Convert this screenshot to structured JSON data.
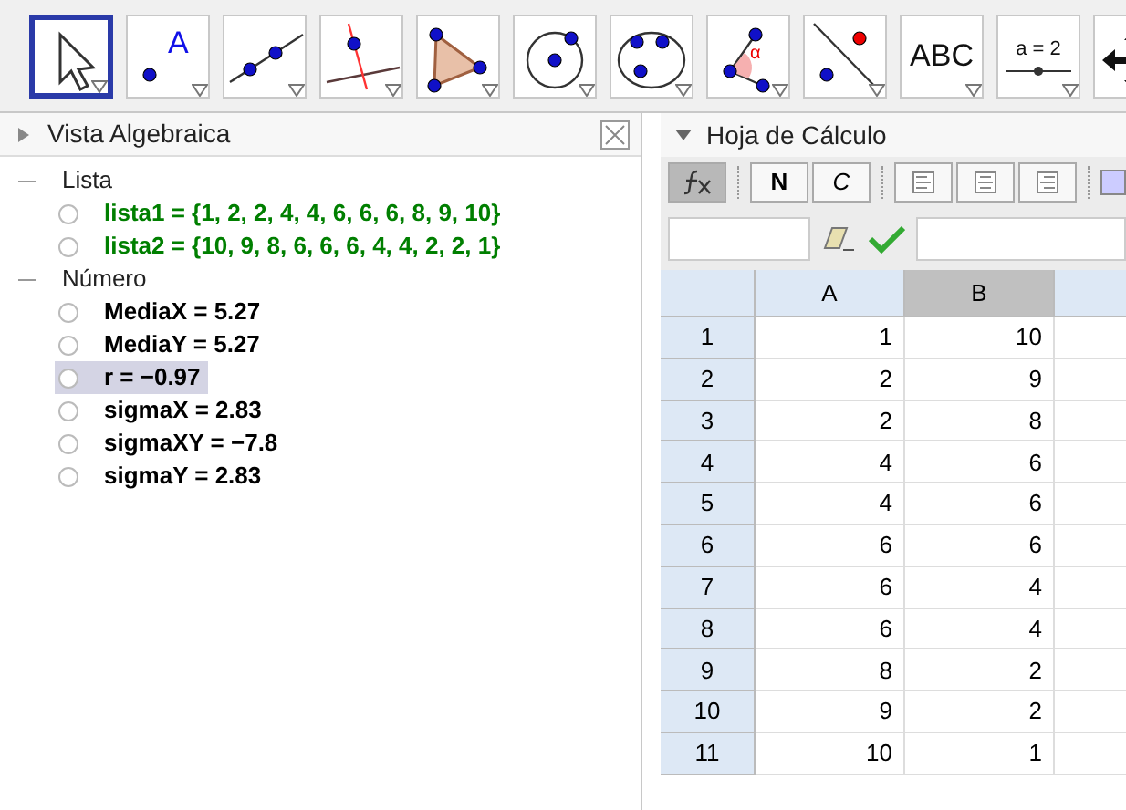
{
  "toolbar": [
    {
      "kind": "move",
      "selected": true,
      "menu_arrow": true
    },
    {
      "kind": "point",
      "label": "A",
      "selected": false,
      "menu_arrow": true
    },
    {
      "kind": "line",
      "selected": false,
      "menu_arrow": true
    },
    {
      "kind": "perpendicular",
      "selected": false,
      "menu_arrow": true
    },
    {
      "kind": "polygon",
      "selected": false,
      "menu_arrow": true
    },
    {
      "kind": "circle",
      "selected": false,
      "menu_arrow": true
    },
    {
      "kind": "conic",
      "selected": false,
      "menu_arrow": true
    },
    {
      "kind": "angle",
      "label": "α",
      "selected": false,
      "menu_arrow": true
    },
    {
      "kind": "reflect",
      "selected": false,
      "menu_arrow": true
    },
    {
      "kind": "text",
      "label": "ABC",
      "selected": false,
      "menu_arrow": true
    },
    {
      "kind": "slider",
      "label": "a = 2",
      "selected": false,
      "menu_arrow": true
    },
    {
      "kind": "pan",
      "selected": false,
      "menu_arrow": false
    }
  ],
  "algebra_view": {
    "title": "Vista Algebraica",
    "groups": [
      {
        "name": "Lista",
        "expanded": true,
        "items": [
          {
            "text": "lista1 = {1, 2, 2, 4, 4, 6, 6, 6, 8, 9, 10}",
            "color": "#007f00",
            "selected": false
          },
          {
            "text": "lista2 = {10, 9, 8, 6, 6, 6, 4, 4, 2, 2, 1}",
            "color": "#007f00",
            "selected": false
          }
        ]
      },
      {
        "name": "Número",
        "expanded": true,
        "items": [
          {
            "text": "MediaX = 5.27",
            "color": "#000000",
            "selected": false
          },
          {
            "text": "MediaY = 5.27",
            "color": "#000000",
            "selected": false
          },
          {
            "text": "r = −0.97",
            "color": "#000000",
            "selected": true
          },
          {
            "text": "sigmaX = 2.83",
            "color": "#000000",
            "selected": false
          },
          {
            "text": "sigmaXY = −7.8",
            "color": "#000000",
            "selected": false
          },
          {
            "text": "sigmaY = 2.83",
            "color": "#000000",
            "selected": false
          }
        ]
      }
    ]
  },
  "spreadsheet": {
    "title": "Hoja de Cálculo",
    "style_buttons": [
      {
        "kind": "fx",
        "selected": true
      },
      {
        "kind": "bold",
        "label": "N",
        "selected": false
      },
      {
        "kind": "italic",
        "label": "C",
        "selected": false
      },
      {
        "kind": "align-left",
        "selected": false
      },
      {
        "kind": "align-center",
        "selected": false
      },
      {
        "kind": "align-right",
        "selected": false
      }
    ],
    "columns": [
      {
        "label": "A",
        "selected": false
      },
      {
        "label": "B",
        "selected": true
      }
    ],
    "rows": [
      {
        "label": "1",
        "cells": [
          "1",
          "10"
        ]
      },
      {
        "label": "2",
        "cells": [
          "2",
          "9"
        ]
      },
      {
        "label": "3",
        "cells": [
          "2",
          "8"
        ]
      },
      {
        "label": "4",
        "cells": [
          "4",
          "6"
        ]
      },
      {
        "label": "5",
        "cells": [
          "4",
          "6"
        ]
      },
      {
        "label": "6",
        "cells": [
          "6",
          "6"
        ]
      },
      {
        "label": "7",
        "cells": [
          "6",
          "4"
        ]
      },
      {
        "label": "8",
        "cells": [
          "6",
          "4"
        ]
      },
      {
        "label": "9",
        "cells": [
          "8",
          "2"
        ]
      },
      {
        "label": "10",
        "cells": [
          "9",
          "2"
        ]
      },
      {
        "label": "11",
        "cells": [
          "10",
          "1"
        ]
      }
    ]
  }
}
